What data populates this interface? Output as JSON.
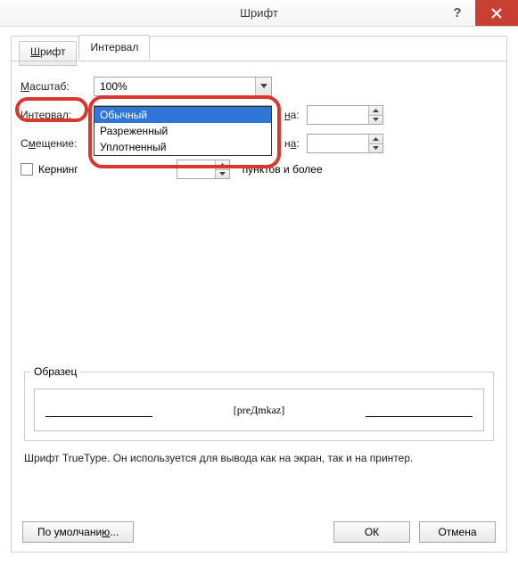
{
  "title": "Шрифт",
  "tabs": {
    "font": "Шрифт",
    "interval": "Интервал"
  },
  "labels": {
    "scale": "Масштаб:",
    "interval": "Интервал:",
    "offset": "Смещение:",
    "na": "на:",
    "kerning_pre": "Кернинг",
    "kerning_post": "пунктов и более",
    "sample_legend": "Образец",
    "sample_text": "[preДmkaz]",
    "desc": "Шрифт TrueType. Он используется для вывода как на экран, так и на принтер."
  },
  "values": {
    "scale": "100%",
    "interval": "Обычный",
    "interval_options": [
      "Обычный",
      "Разреженный",
      "Уплотненный"
    ]
  },
  "buttons": {
    "defaults": "По умолчанию...",
    "ok": "ОК",
    "cancel": "Отмена"
  }
}
